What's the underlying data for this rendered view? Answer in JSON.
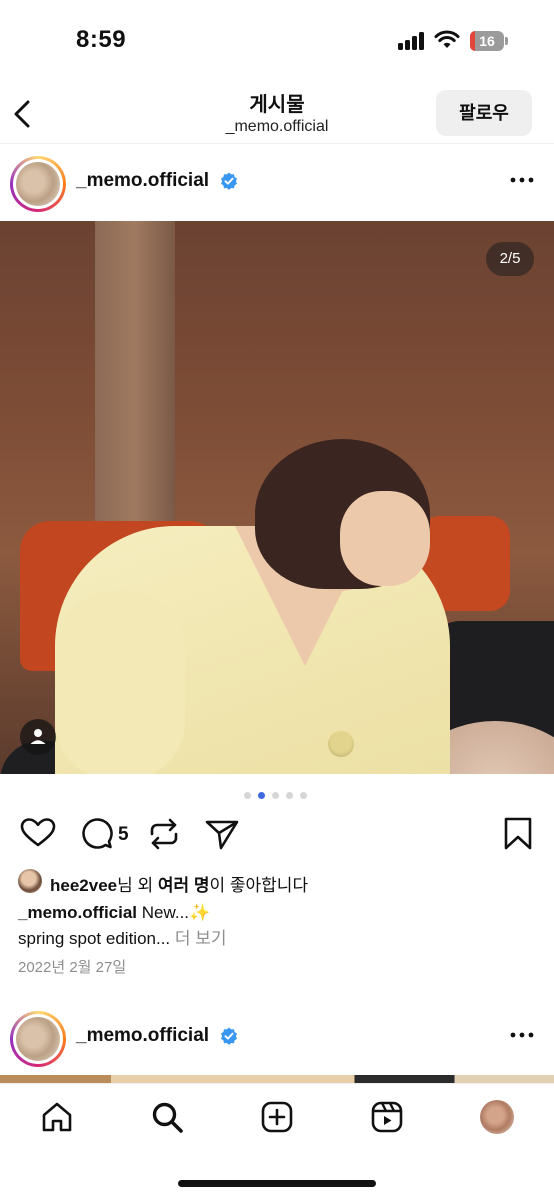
{
  "status_bar": {
    "time": "8:59",
    "battery": "16"
  },
  "header": {
    "title": "게시물",
    "subtitle": "_memo.official",
    "follow_label": "팔로우"
  },
  "post": {
    "username": "_memo.official",
    "image_counter": "2/5",
    "page_dots": {
      "count": 5,
      "active_index": 1
    },
    "comment_count": "5",
    "likes": {
      "user": "hee2vee",
      "mid": "님 외 ",
      "others": "여러 명",
      "end": "이 좋아합니다"
    },
    "caption": {
      "user": "_memo.official",
      "line1": " New...✨",
      "line2": "spring spot edition... ",
      "more": "더 보기"
    },
    "date": "2022년 2월 27일"
  },
  "next_post": {
    "username": "_memo.official"
  },
  "colors": {
    "accent_blue": "#3897f0",
    "active_dot": "#3e6ae1",
    "muted": "#8e8e8e"
  },
  "nav": {
    "items": [
      "home-icon",
      "search-icon",
      "create-icon",
      "reels-icon",
      "profile-avatar"
    ]
  }
}
